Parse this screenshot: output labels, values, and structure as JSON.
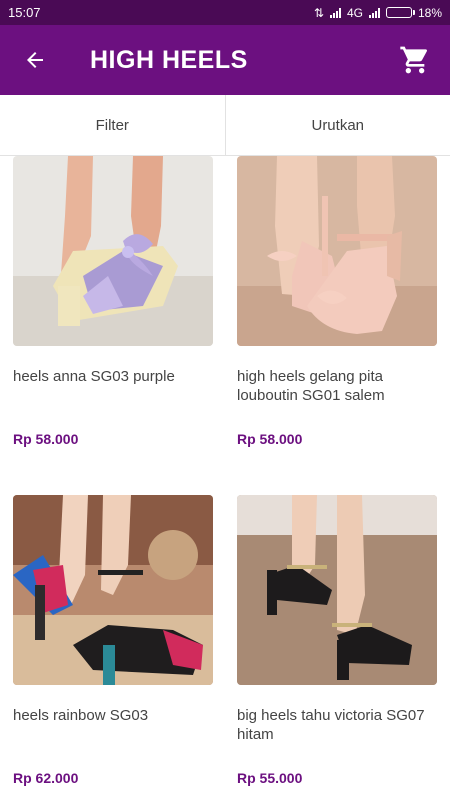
{
  "status": {
    "time": "15:07",
    "network": "4G",
    "battery": "18%"
  },
  "header": {
    "title": "HIGH HEELS"
  },
  "actions": {
    "filter": "Filter",
    "sort": "Urutkan"
  },
  "products": [
    {
      "name": "heels anna SG03 purple",
      "price": "Rp 58.000"
    },
    {
      "name": "high heels gelang pita louboutin SG01 salem",
      "price": "Rp 58.000"
    },
    {
      "name": "heels rainbow SG03",
      "price": "Rp 62.000"
    },
    {
      "name": "big heels tahu victoria SG07 hitam",
      "price": "Rp 55.000"
    }
  ],
  "colors": {
    "app_bar": "#6c1080",
    "status_bar": "#4a0a55",
    "price": "#6c1080"
  },
  "icons": {
    "back": "arrow-back-icon",
    "cart": "shopping-cart-icon"
  }
}
